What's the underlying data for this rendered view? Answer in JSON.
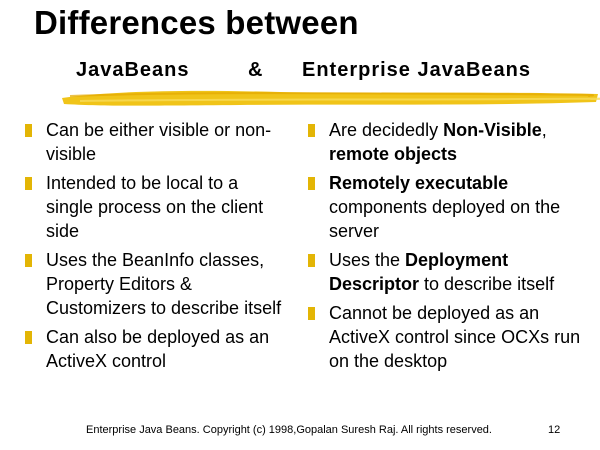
{
  "slide": {
    "title": "Differences between",
    "subtitle": {
      "left": "JavaBeans",
      "amp": "&",
      "right": "Enterprise JavaBeans"
    },
    "accent_color": "#e3b505",
    "left_column": [
      {
        "parts": [
          {
            "text": "Can be either visible or non-visible",
            "bold": false
          }
        ]
      },
      {
        "parts": [
          {
            "text": "Intended to be local to a single process on the client side",
            "bold": false
          }
        ]
      },
      {
        "parts": [
          {
            "text": "Uses the BeanInfo classes, Property Editors & Customizers to describe itself",
            "bold": false
          }
        ]
      },
      {
        "parts": [
          {
            "text": "Can also be deployed as an ActiveX control",
            "bold": false
          }
        ]
      }
    ],
    "right_column": [
      {
        "parts": [
          {
            "text": "Are decidedly ",
            "bold": false
          },
          {
            "text": "Non-Visible",
            "bold": true
          },
          {
            "text": ", ",
            "bold": false
          },
          {
            "text": "remote objects",
            "bold": true
          }
        ]
      },
      {
        "parts": [
          {
            "text": "Remotely executable",
            "bold": true
          },
          {
            "text": " components deployed on the server",
            "bold": false
          }
        ]
      },
      {
        "parts": [
          {
            "text": "Uses the ",
            "bold": false
          },
          {
            "text": "Deployment Descriptor",
            "bold": true
          },
          {
            "text": " to describe itself",
            "bold": false
          }
        ]
      },
      {
        "parts": [
          {
            "text": "Cannot be deployed as an ActiveX control since OCXs run on the desktop",
            "bold": false
          }
        ]
      }
    ],
    "footer": "Enterprise Java Beans. Copyright (c) 1998,Gopalan Suresh Raj. All rights reserved.",
    "page_number": "12"
  }
}
